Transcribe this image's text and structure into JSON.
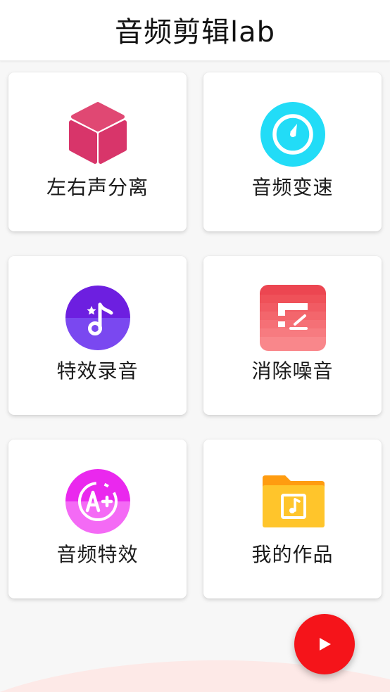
{
  "header": {
    "title": "音频剪辑lab"
  },
  "cards": [
    {
      "label": "左右声分离",
      "icon": "cube-icon",
      "color": "#dd3b6a"
    },
    {
      "label": "音频变速",
      "icon": "speedometer-icon",
      "color": "#1fd9f6"
    },
    {
      "label": "特效录音",
      "icon": "music-note-icon",
      "color": "#6a3df0"
    },
    {
      "label": "消除噪音",
      "icon": "equalizer-edit-icon",
      "color": "#f2555e"
    },
    {
      "label": "音频特效",
      "icon": "a-plus-badge-icon",
      "color": "#ee3cf2"
    },
    {
      "label": "我的作品",
      "icon": "music-folder-icon",
      "color": "#ffc227"
    }
  ],
  "fab": {
    "icon": "play-icon",
    "color": "#f5141a"
  },
  "colors": {
    "background": "#f7f7f7",
    "card": "#ffffff",
    "wave": "#fde9e7"
  }
}
